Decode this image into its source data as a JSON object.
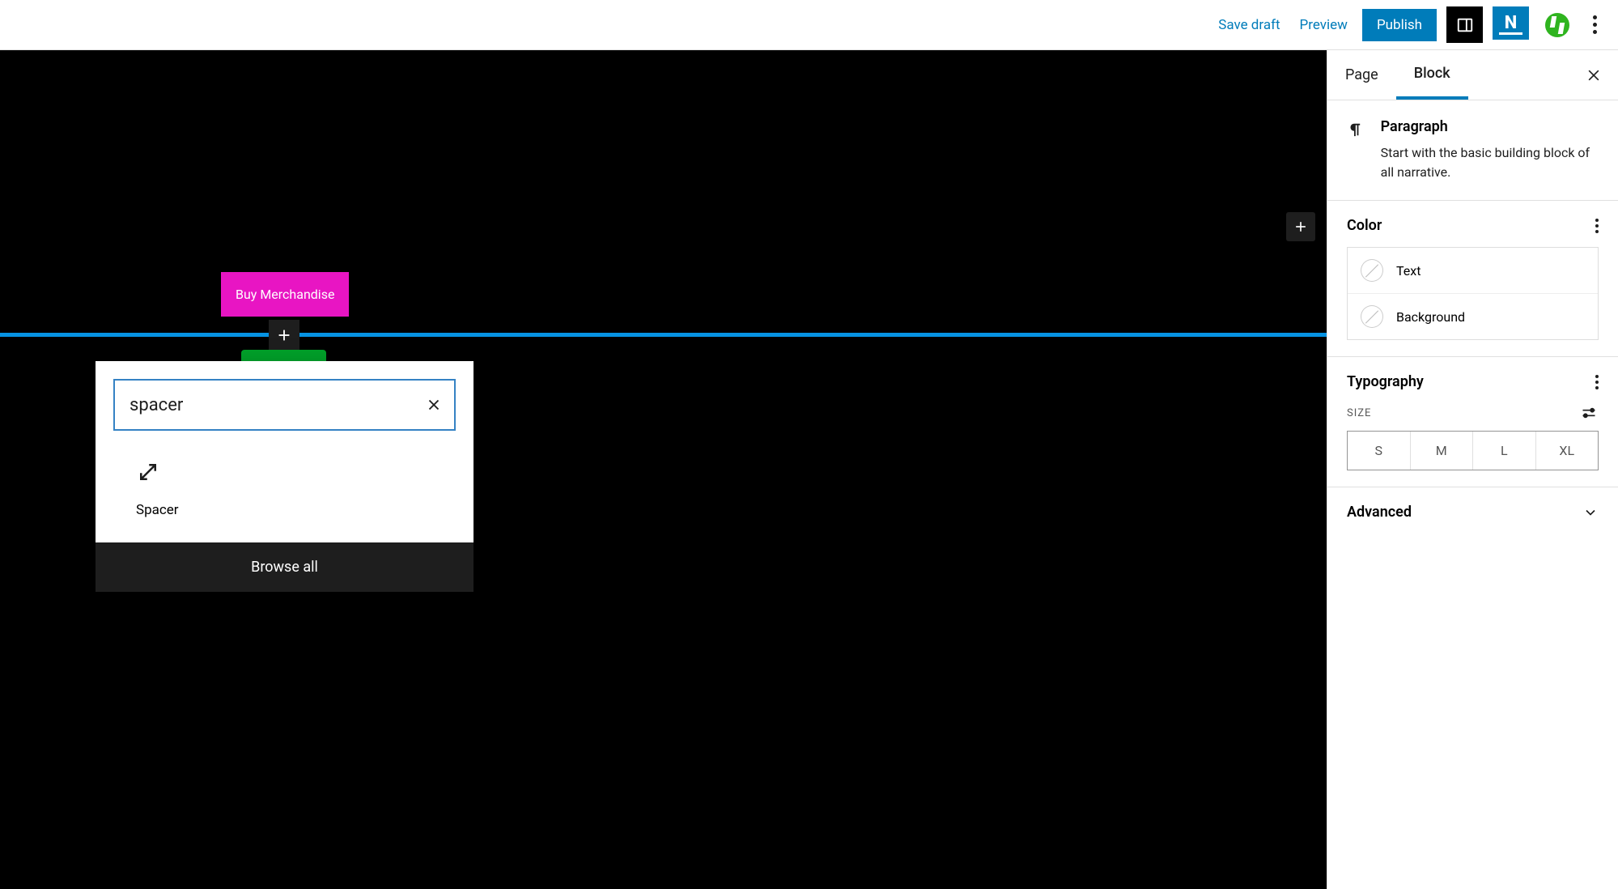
{
  "topbar": {
    "save_draft": "Save draft",
    "preview": "Preview",
    "publish": "Publish"
  },
  "canvas": {
    "buy_button": "Buy Merchandise"
  },
  "inserter": {
    "search_value": "spacer",
    "result_label": "Spacer",
    "browse_all": "Browse all"
  },
  "sidebar": {
    "tabs": {
      "page": "Page",
      "block": "Block"
    },
    "block_info": {
      "title": "Paragraph",
      "description": "Start with the basic building block of all narrative."
    },
    "color": {
      "heading": "Color",
      "text": "Text",
      "background": "Background"
    },
    "typography": {
      "heading": "Typography",
      "size_label": "SIZE",
      "sizes": [
        "S",
        "M",
        "L",
        "XL"
      ]
    },
    "advanced": {
      "heading": "Advanced"
    }
  }
}
